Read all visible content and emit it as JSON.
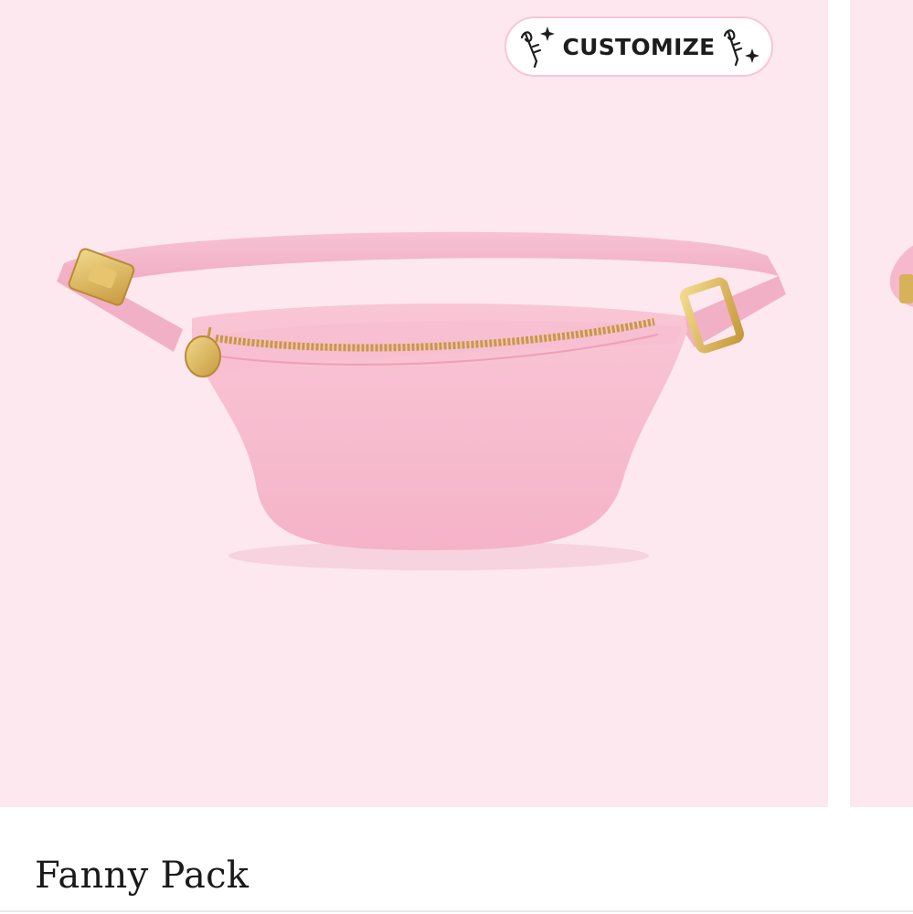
{
  "product": {
    "title": "Fanny Pack",
    "badge_label": "CUSTOMIZE",
    "badge_icon_left": "patch-pin-sparkle-icon",
    "badge_icon_right": "patch-pin-sparkle-icon",
    "image_alt": "fanny-pack-pink",
    "colors": {
      "background": "#fde8f0",
      "bag": "#f5b8cc",
      "zipper": "#c9a24a"
    }
  }
}
